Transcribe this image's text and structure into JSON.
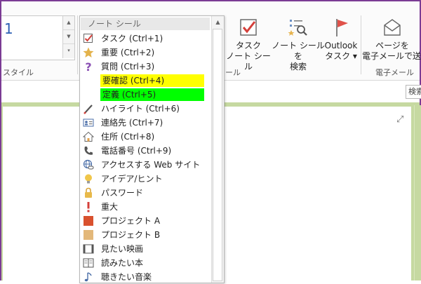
{
  "ribbon": {
    "style_group_label": "スタイル",
    "style_gallery_fragment": "1",
    "partial_group_label": "ール",
    "email_group_label": "電子メール",
    "buttons": {
      "task": {
        "line1": "タスク",
        "line2": "ノート シール"
      },
      "search": {
        "line1": "ノート シールを",
        "line2": "検索"
      },
      "outlook": {
        "line1": "Outlook",
        "line2": "タスク ▾"
      },
      "email": {
        "line1": "ページを",
        "line2": "電子メールで送信"
      }
    }
  },
  "search_field": {
    "value": "検索"
  },
  "note_tags_menu": {
    "header": "ノート シール",
    "items": [
      {
        "label": "タスク (Ctrl+1)",
        "icon": "checkbox-checked-icon"
      },
      {
        "label": "重要 (Ctrl+2)",
        "icon": "star-icon"
      },
      {
        "label": "質問 (Ctrl+3)",
        "icon": "question-icon"
      },
      {
        "label": "要確認 (Ctrl+4)",
        "icon": "none",
        "highlight": "#ffff00"
      },
      {
        "label": "定義 (Ctrl+5)",
        "icon": "none",
        "highlight": "#00ff00"
      },
      {
        "label": "ハイライト (Ctrl+6)",
        "icon": "highlighter-pen-icon"
      },
      {
        "label": "連絡先 (Ctrl+7)",
        "icon": "contact-card-icon"
      },
      {
        "label": "住所 (Ctrl+8)",
        "icon": "house-icon"
      },
      {
        "label": "電話番号 (Ctrl+9)",
        "icon": "phone-icon"
      },
      {
        "label": "アクセスする Web サイト",
        "icon": "globe-link-icon"
      },
      {
        "label": "アイデア/ヒント",
        "icon": "lightbulb-icon"
      },
      {
        "label": "パスワード",
        "icon": "lock-icon"
      },
      {
        "label": "重大",
        "icon": "exclamation-icon"
      },
      {
        "label": "プロジェクト A",
        "icon": "red-square-icon"
      },
      {
        "label": "プロジェクト B",
        "icon": "tan-square-icon"
      },
      {
        "label": "見たい映画",
        "icon": "film-icon"
      },
      {
        "label": "読みたい本",
        "icon": "book-icon"
      },
      {
        "label": "聴きたい音楽",
        "icon": "music-note-icon"
      }
    ]
  },
  "colors": {
    "frame": "#7b3b94",
    "page_band": "#c6d9a1",
    "highlight_yellow": "#ffff00",
    "highlight_green": "#00ff00",
    "task_check": "#d43f3a",
    "flag_red": "#e0524a"
  }
}
